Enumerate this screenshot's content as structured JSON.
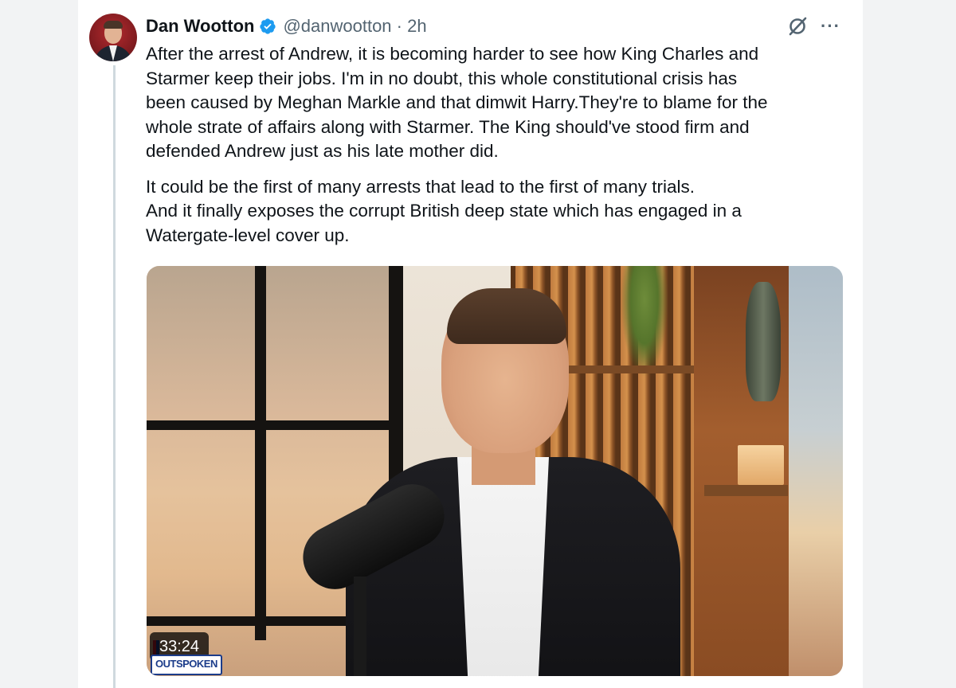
{
  "author": {
    "name": "Dan Wootton",
    "handle": "@danwootton · 2h",
    "verified_color": "#1d9bf0"
  },
  "icons": {
    "grok": "grok-icon",
    "more": "···"
  },
  "tweet": {
    "paragraph1": "After the arrest of Andrew, it is becoming harder to see how King Charles and\nStarmer keep their jobs.  I'm in no doubt, this whole constitutional crisis has\nbeen caused by Meghan Markle and that dimwit Harry.They're to blame for the\nwhole strate of affairs along with Starmer. The King should've stood firm and\ndefended Andrew just as his late mother did.",
    "paragraph2": "It could be the first of many arrests that lead to the first of many trials.\nAnd it finally exposes the corrupt British deep state which has engaged in a\nWatergate-level cover up."
  },
  "media": {
    "duration": "33:24",
    "logo_text": "OUTSPOKEN"
  }
}
